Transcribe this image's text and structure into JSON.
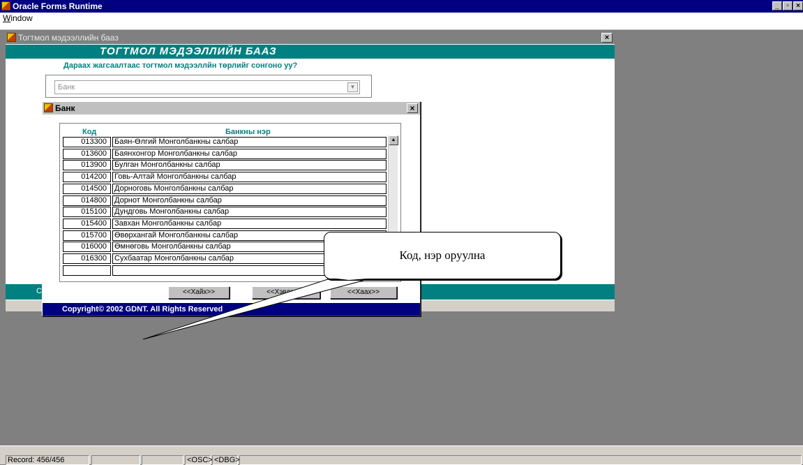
{
  "app": {
    "title": "Oracle Forms Runtime",
    "win_buttons": [
      "_",
      "▫",
      "×"
    ]
  },
  "menu": {
    "window_prefix": "W",
    "window_rest": "indow"
  },
  "form": {
    "window_title": "Тогтмол мэдээллийн бааз",
    "header": "ТОГТМОЛ МЭДЭЭЛЛИЙН БААЗ",
    "prompt": "Дараах жагсаалтаас тогтмол мэдээллйн төрлийг сонгоно уу?",
    "combo_value": "Банк",
    "bottom_text": "С",
    "close": "×"
  },
  "dialog": {
    "title": "Банк",
    "close": "×",
    "col_code": "Код",
    "col_name": "Банкны нэр",
    "rows": [
      {
        "code": "013300",
        "name": "Баян-Өлгий Монголбанкны салбар"
      },
      {
        "code": "013600",
        "name": "Баянхонгор Монголбанкны салбар"
      },
      {
        "code": "013900",
        "name": "Булган Монголбанкны салбар"
      },
      {
        "code": "014200",
        "name": "Говь-Алтай Монголбанкны салбар"
      },
      {
        "code": "014500",
        "name": "Дорноговь Монголбанкны салбар"
      },
      {
        "code": "014800",
        "name": "Дорнот Монголбанкны салбар"
      },
      {
        "code": "015100",
        "name": "Дундговь Монголбанкны салбар"
      },
      {
        "code": "015400",
        "name": "Завхан Монголбанкны салбар"
      },
      {
        "code": "015700",
        "name": "Өвөрхангай Монголбанкны салбар"
      },
      {
        "code": "016000",
        "name": "Өмнөговь Монголбанкны салбар"
      },
      {
        "code": "016300",
        "name": "Сухбаатар Монголбанкны салбар"
      },
      {
        "code": "",
        "name": ""
      }
    ],
    "buttons": {
      "search": "<<Хайх>>",
      "save": "<<Хэвлэх>>",
      "close": "<<Хаах>>"
    },
    "copyright": "Copyright© 2002 GDNT. All Rights Reserved"
  },
  "callout": {
    "text": "Код, нэр оруулна"
  },
  "status": {
    "record": "Record: 456/456",
    "osc": "<OSC>",
    "dbg": "<DBG>"
  }
}
